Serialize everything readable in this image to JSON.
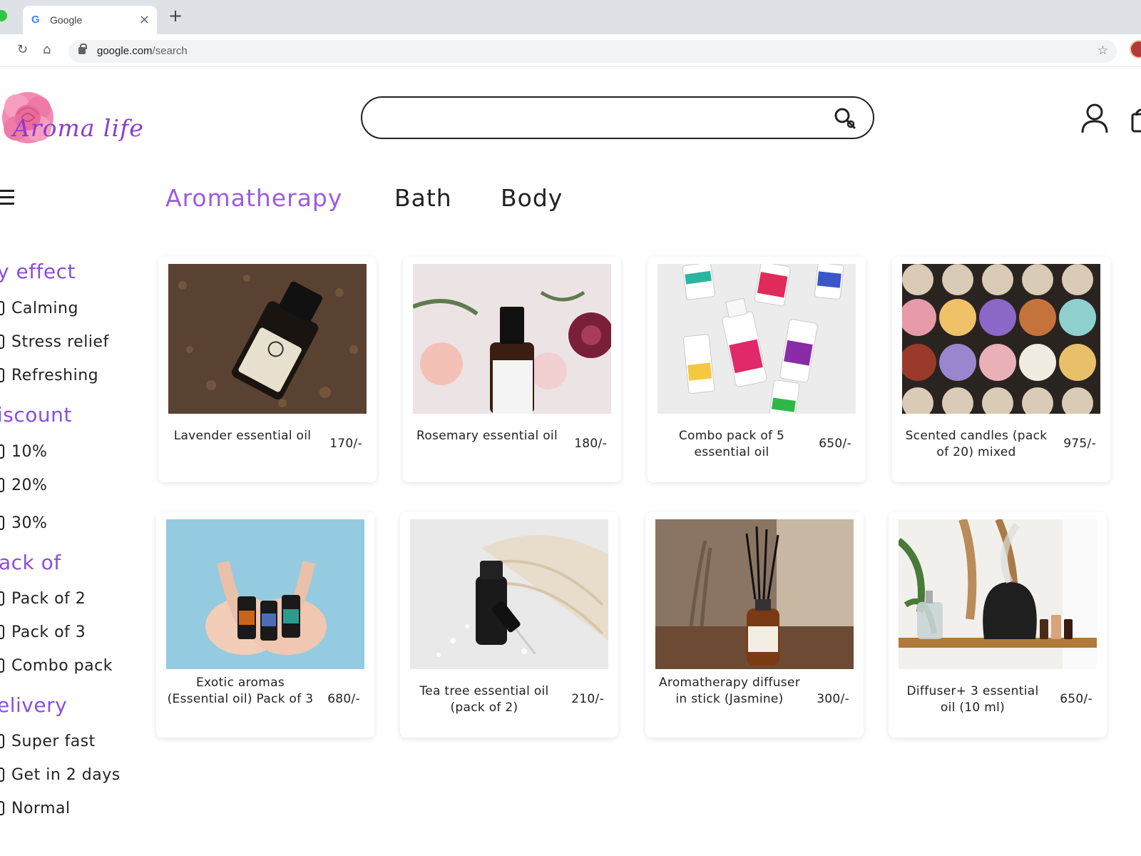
{
  "browser": {
    "tab_title": "Google",
    "tab_favicon": "G",
    "url_domain": "google.com",
    "url_path": "/search"
  },
  "site": {
    "logo_text": "Aroma life",
    "search_placeholder": ""
  },
  "categories": [
    {
      "label": "Aromatherapy",
      "active": true
    },
    {
      "label": "Bath",
      "active": false
    },
    {
      "label": "Body",
      "active": false
    }
  ],
  "filters": [
    {
      "heading": "y effect",
      "options": [
        "Calming",
        "Stress relief",
        "Refreshing"
      ]
    },
    {
      "heading": "iscount",
      "options": [
        "10%",
        "20%",
        "30%"
      ]
    },
    {
      "heading": "ack of",
      "options": [
        "Pack of 2",
        "Pack of 3",
        "Combo pack"
      ]
    },
    {
      "heading": "elivery",
      "options": [
        "Super fast",
        "Get in 2 days",
        "Normal"
      ]
    }
  ],
  "products": [
    {
      "name": "Lavender essential oil",
      "price": "170/-"
    },
    {
      "name": "Rosemary essential oil",
      "price": "180/-"
    },
    {
      "name": "Combo pack of 5 essential oil",
      "price": "650/-"
    },
    {
      "name": "Scented candles (pack of 20) mixed",
      "price": "975/-"
    },
    {
      "name": "Exotic aromas (Essential oil) Pack of 3",
      "price": "680/-"
    },
    {
      "name": "Tea tree essential oil (pack of 2)",
      "price": "210/-"
    },
    {
      "name": "Aromatherapy diffuser in stick (Jasmine)",
      "price": "300/-"
    },
    {
      "name": "Diffuser+ 3 essential oil (10 ml)",
      "price": "650/-"
    }
  ],
  "colors": {
    "accent": "#9c5ce0",
    "filter_heading": "#8a4fdb",
    "text": "#222222"
  },
  "icons": {
    "search": "search-icon",
    "user": "user-icon",
    "cart": "cart-icon",
    "menu": "hamburger-menu-icon"
  }
}
